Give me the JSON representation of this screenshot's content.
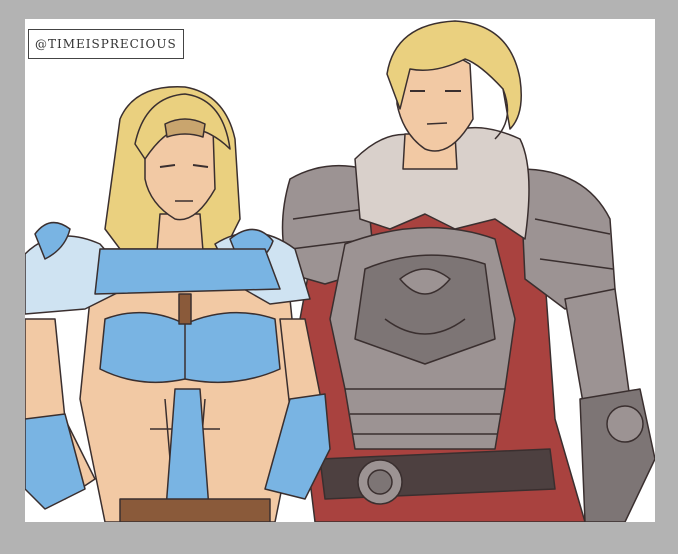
{
  "watermark": {
    "text": "@TIMEISPRECIOUS"
  },
  "colors": {
    "page_border": "#b3b3b3",
    "canvas": "#ffffff",
    "skin": "#f2c9a4",
    "hair_blonde": "#ead07f",
    "blue_armor": "#79b4e3",
    "pale_blue": "#cfe3f2",
    "steel": "#9c9393",
    "steel_dark": "#7d7575",
    "red_tunic": "#a9423f",
    "fur": "#d9d0cb",
    "belt": "#4d4040",
    "line": "#3a2f2f"
  }
}
